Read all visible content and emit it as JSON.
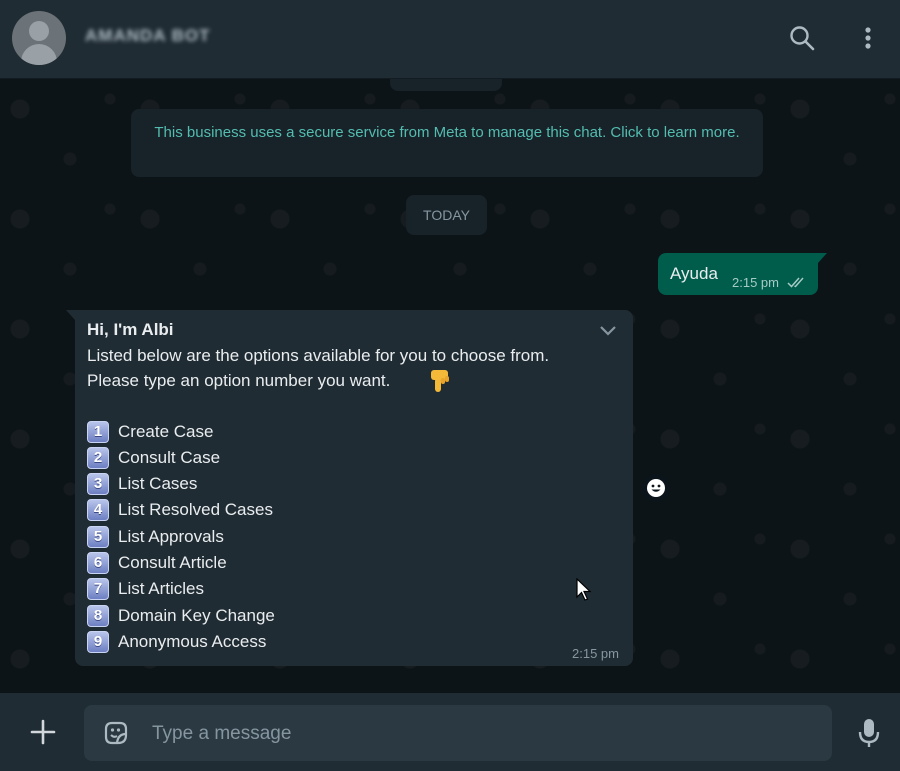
{
  "header": {
    "contact_name": "AMANDA BOT",
    "icons": {
      "search": "search-icon",
      "menu": "kebab-menu-icon",
      "avatar": "avatar-icon"
    }
  },
  "chat": {
    "secure_notice": "This business uses a secure service from Meta to manage this chat. Click to learn more.",
    "date_chip": "TODAY",
    "outgoing": {
      "text": "Ayuda",
      "time": "2:15 pm",
      "status": "read"
    },
    "incoming": {
      "title": "Hi, I'm Albi",
      "line1": "Listed below are the options available for you to choose from.",
      "line2": "Please type an option number you want.",
      "options": [
        {
          "number": "1",
          "label": "Create Case"
        },
        {
          "number": "2",
          "label": "Consult Case"
        },
        {
          "number": "3",
          "label": "List Cases"
        },
        {
          "number": "4",
          "label": "List Resolved Cases"
        },
        {
          "number": "5",
          "label": "List Approvals"
        },
        {
          "number": "6",
          "label": "Consult Article"
        },
        {
          "number": "7",
          "label": "List Articles"
        },
        {
          "number": "8",
          "label": "Domain Key Change"
        },
        {
          "number": "9",
          "label": "Anonymous Access"
        }
      ],
      "time": "2:15 pm"
    }
  },
  "composer": {
    "placeholder": "Type a message",
    "value": ""
  },
  "colors": {
    "header_bg": "#202c33",
    "chat_bg": "#0b141a",
    "outgoing_bubble": "#005c4b",
    "incoming_bubble": "#202c33",
    "notice_text": "#53bdb0",
    "text": "#e9edef",
    "muted": "#8696a0"
  }
}
